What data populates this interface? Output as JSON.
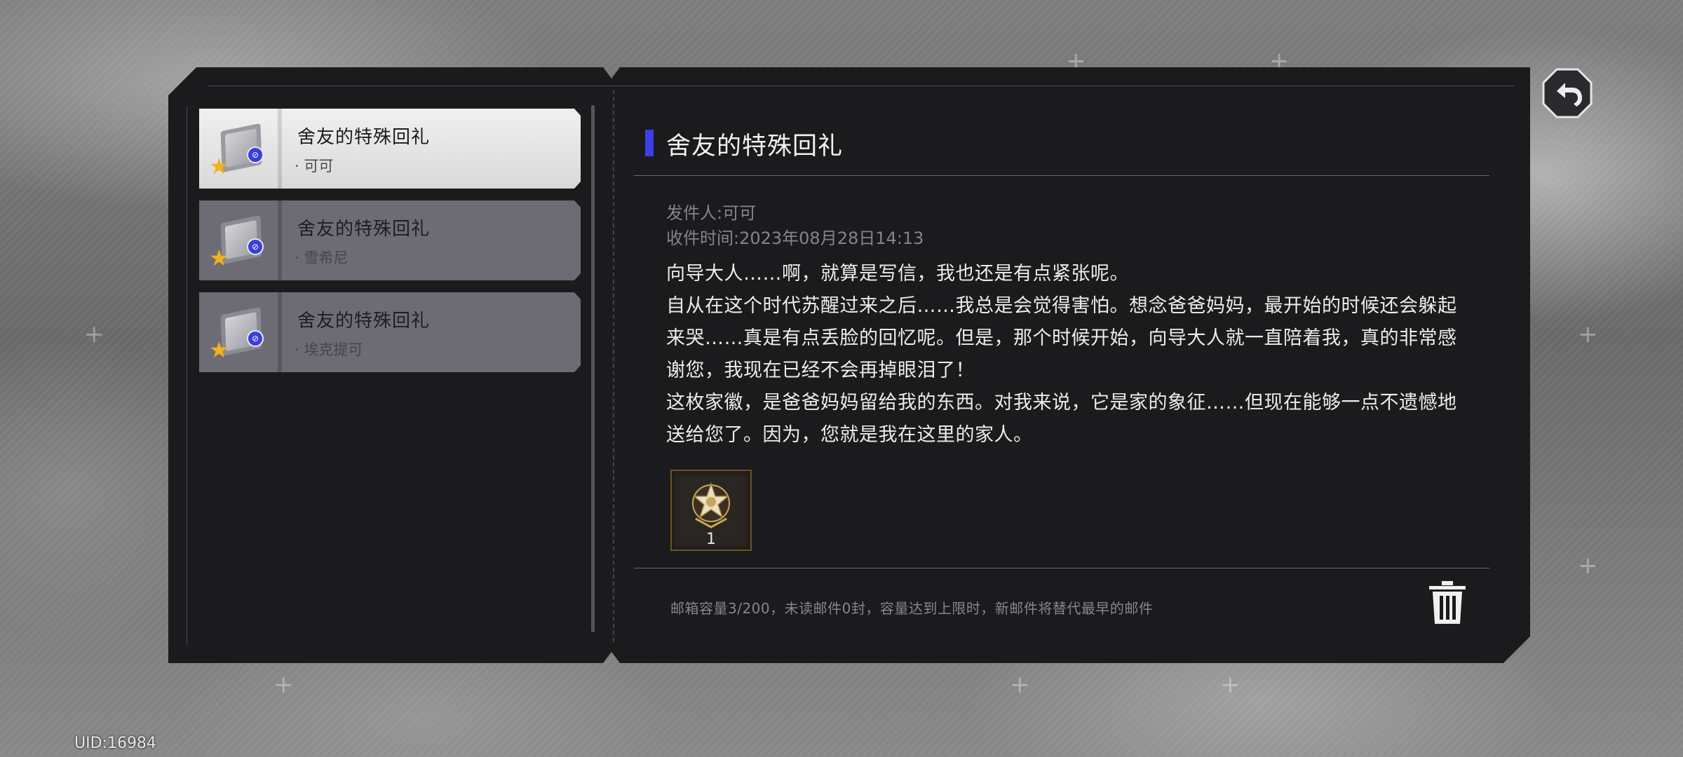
{
  "mail_list": [
    {
      "title": "舍友的特殊回礼",
      "sender": "可可",
      "active": true
    },
    {
      "title": "舍友的特殊回礼",
      "sender": "雪希尼",
      "active": false
    },
    {
      "title": "舍友的特殊回礼",
      "sender": "埃克提可",
      "active": false
    }
  ],
  "mail": {
    "title": "舍友的特殊回礼",
    "sender_line": "发件人:可可",
    "time_line": "收件时间:2023年08月28日14:13",
    "paragraphs": [
      "向导大人……啊，就算是写信，我也还是有点紧张呢。",
      "自从在这个时代苏醒过来之后……我总是会觉得害怕。想念爸爸妈妈，最开始的时候还会躲起来哭……真是有点丢脸的回忆呢。但是，那个时候开始，向导大人就一直陪着我，真的非常感谢您，我现在已经不会再掉眼泪了！",
      "这枚家徽，是爸爸妈妈留给我的东西。对我来说，它是家的象征……但现在能够一点不遗憾地送给您了。因为，您就是我在这里的家人。"
    ],
    "attachment": {
      "quantity": "1",
      "icon": "family-crest-icon"
    }
  },
  "footer": {
    "capacity_note": "邮箱容量3/200，未读邮件0封，容量达到上限时，新邮件将替代最早的邮件"
  },
  "uid": "UID:16984",
  "colors": {
    "accent": "#3e3ee8",
    "star": "#f2b21c"
  }
}
